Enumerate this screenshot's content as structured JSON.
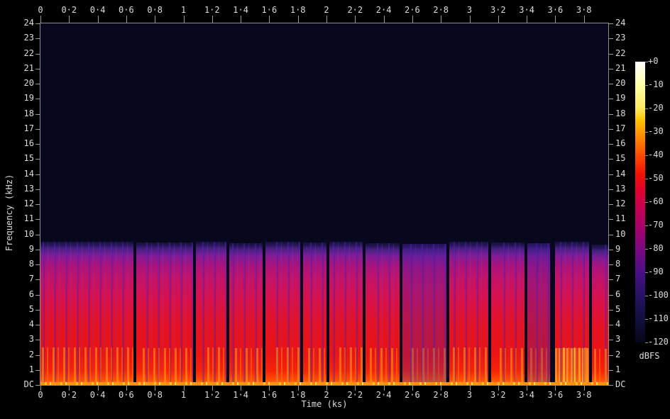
{
  "window": {
    "background": "#000000"
  },
  "chart_data": {
    "type": "heatmap",
    "subtype": "audio-spectrogram",
    "title": "",
    "xlabel": "Time (ks)",
    "ylabel": "Frequency (kHz)",
    "x_range_ks": [
      0,
      3.97
    ],
    "y_range_khz": [
      0,
      24
    ],
    "grid": false,
    "x_ticks": [
      {
        "v": 0.0,
        "label": "0"
      },
      {
        "v": 0.2,
        "label": "0·2"
      },
      {
        "v": 0.4,
        "label": "0·4"
      },
      {
        "v": 0.6,
        "label": "0·6"
      },
      {
        "v": 0.8,
        "label": "0·8"
      },
      {
        "v": 1.0,
        "label": "1"
      },
      {
        "v": 1.2,
        "label": "1·2"
      },
      {
        "v": 1.4,
        "label": "1·4"
      },
      {
        "v": 1.6,
        "label": "1·6"
      },
      {
        "v": 1.8,
        "label": "1·8"
      },
      {
        "v": 2.0,
        "label": "2"
      },
      {
        "v": 2.2,
        "label": "2·2"
      },
      {
        "v": 2.4,
        "label": "2·4"
      },
      {
        "v": 2.6,
        "label": "2·6"
      },
      {
        "v": 2.8,
        "label": "2·8"
      },
      {
        "v": 3.0,
        "label": "3"
      },
      {
        "v": 3.2,
        "label": "3·2"
      },
      {
        "v": 3.4,
        "label": "3·4"
      },
      {
        "v": 3.6,
        "label": "3·6"
      },
      {
        "v": 3.8,
        "label": "3·8"
      }
    ],
    "y_ticks": [
      {
        "v": 24,
        "label": "24"
      },
      {
        "v": 23,
        "label": "23"
      },
      {
        "v": 22,
        "label": "22"
      },
      {
        "v": 21,
        "label": "21"
      },
      {
        "v": 20,
        "label": "20"
      },
      {
        "v": 19,
        "label": "19"
      },
      {
        "v": 18,
        "label": "18"
      },
      {
        "v": 17,
        "label": "17"
      },
      {
        "v": 16,
        "label": "16"
      },
      {
        "v": 15,
        "label": "15"
      },
      {
        "v": 14,
        "label": "14"
      },
      {
        "v": 13,
        "label": "13"
      },
      {
        "v": 12,
        "label": "12"
      },
      {
        "v": 11,
        "label": "11"
      },
      {
        "v": 10,
        "label": "10"
      },
      {
        "v": 9,
        "label": "9"
      },
      {
        "v": 8,
        "label": "8"
      },
      {
        "v": 7,
        "label": "7"
      },
      {
        "v": 6,
        "label": "6"
      },
      {
        "v": 5,
        "label": "5"
      },
      {
        "v": 4,
        "label": "4"
      },
      {
        "v": 3,
        "label": "3"
      },
      {
        "v": 2,
        "label": "2"
      },
      {
        "v": 1,
        "label": "1"
      },
      {
        "v": 0,
        "label": "DC"
      }
    ],
    "colorbar": {
      "label": "dBFS",
      "range_db": [
        0,
        -120
      ],
      "ticks": [
        {
          "db": 0,
          "label": "+0"
        },
        {
          "db": -10,
          "label": "-10"
        },
        {
          "db": -20,
          "label": "-20"
        },
        {
          "db": -30,
          "label": "-30"
        },
        {
          "db": -40,
          "label": "-40"
        },
        {
          "db": -50,
          "label": "-50"
        },
        {
          "db": -60,
          "label": "-60"
        },
        {
          "db": -70,
          "label": "-70"
        },
        {
          "db": -80,
          "label": "-80"
        },
        {
          "db": -90,
          "label": "-90"
        },
        {
          "db": -100,
          "label": "-100"
        },
        {
          "db": -110,
          "label": "-110"
        },
        {
          "db": -120,
          "label": "-120"
        }
      ],
      "palette": [
        {
          "db": 0,
          "color": "#ffffff"
        },
        {
          "db": -10,
          "color": "#ffffaa"
        },
        {
          "db": -20,
          "color": "#ffe95e"
        },
        {
          "db": -25,
          "color": "#ffc400"
        },
        {
          "db": -30,
          "color": "#ff9a00"
        },
        {
          "db": -40,
          "color": "#ff4c00"
        },
        {
          "db": -48,
          "color": "#f31200"
        },
        {
          "db": -55,
          "color": "#e2002e"
        },
        {
          "db": -60,
          "color": "#cf0048"
        },
        {
          "db": -70,
          "color": "#ab0069"
        },
        {
          "db": -80,
          "color": "#7d0883"
        },
        {
          "db": -90,
          "color": "#4a0f86"
        },
        {
          "db": -100,
          "color": "#271263"
        },
        {
          "db": -110,
          "color": "#12103e"
        },
        {
          "db": -120,
          "color": "#06061a"
        }
      ]
    },
    "plot": {
      "background": "#07071d",
      "frame_color": "#8c8c8c",
      "tick_color": "#9a9a9a",
      "label_color": "#dcdcdc"
    },
    "signal": {
      "description": "Broadband audio energy from DC up to a sharp ~9.5 kHz low-pass cutoff; hottest levels (-20 to -40 dBFS, orange/yellow) below 2 kHz, mid band around -50 dBFS (red), fading toward -80 dBFS (purple) near the cutoff; silence at the -120 dBFS floor above 9.5 kHz; narrow silent gaps separate consecutive track segments.",
      "band_khz": [
        0,
        9.5
      ],
      "segments": [
        {
          "start_ks": 0.0,
          "end_ks": 0.65,
          "top_khz": 9.5,
          "tone": "red"
        },
        {
          "start_ks": 0.672,
          "end_ks": 1.068,
          "top_khz": 9.45,
          "tone": "red"
        },
        {
          "start_ks": 1.088,
          "end_ks": 1.3,
          "top_khz": 9.5,
          "tone": "red"
        },
        {
          "start_ks": 1.32,
          "end_ks": 1.555,
          "top_khz": 9.4,
          "tone": "red"
        },
        {
          "start_ks": 1.575,
          "end_ks": 1.815,
          "top_khz": 9.5,
          "tone": "red"
        },
        {
          "start_ks": 1.835,
          "end_ks": 2.0,
          "top_khz": 9.45,
          "tone": "red"
        },
        {
          "start_ks": 2.02,
          "end_ks": 2.255,
          "top_khz": 9.5,
          "tone": "red"
        },
        {
          "start_ks": 2.275,
          "end_ks": 2.51,
          "top_khz": 9.4,
          "tone": "red"
        },
        {
          "start_ks": 2.53,
          "end_ks": 2.84,
          "top_khz": 9.35,
          "tone": "purple"
        },
        {
          "start_ks": 2.86,
          "end_ks": 3.13,
          "top_khz": 9.5,
          "tone": "red"
        },
        {
          "start_ks": 3.15,
          "end_ks": 3.385,
          "top_khz": 9.45,
          "tone": "red"
        },
        {
          "start_ks": 3.405,
          "end_ks": 3.565,
          "top_khz": 9.4,
          "tone": "purple"
        },
        {
          "start_ks": 3.6,
          "end_ks": 3.835,
          "top_khz": 9.5,
          "tone": "hot"
        },
        {
          "start_ks": 3.855,
          "end_ks": 3.97,
          "top_khz": 9.3,
          "tone": "red"
        }
      ]
    }
  }
}
